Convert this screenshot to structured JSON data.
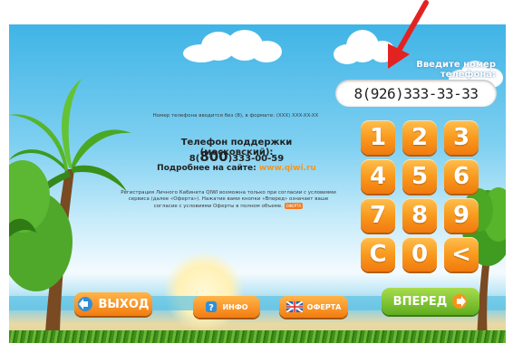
{
  "phone_prompt": "Введите номер телефона:",
  "phone_value": "8(926)333-33-33",
  "hint_text": "Номер телефона вводится без (8), в формате: (XXX) XXX-XX-XX",
  "support": {
    "title": "Телефон поддержки (московский):",
    "phone_prefix": "8(",
    "phone_code": "800",
    "phone_rest": ")333-00-59",
    "site_label": "Подробнее на сайте:",
    "site_url": "www.qiwi.ru"
  },
  "legal": {
    "text": "Регистрация Личного Кабинета QIWI возможна только при согласии с условиями сервиса (далее «Оферта»). Нажатие вами кнопки «Вперед» означает ваше согласие с условиями Оферты в полном объеме.",
    "tag": "ОФЕРТА"
  },
  "keypad": [
    "1",
    "2",
    "3",
    "4",
    "5",
    "6",
    "7",
    "8",
    "9",
    "C",
    "0",
    "<"
  ],
  "buttons": {
    "exit": "ВЫХОД",
    "info": "ИНФО",
    "offer": "ОФЕРТА",
    "next": "ВПЕРЕД"
  },
  "colors": {
    "key_orange": "#f99a1d",
    "next_green": "#5fae1f",
    "arrow_red": "#e32222",
    "link_orange": "#f7941d"
  },
  "icons": {
    "exit": "arrow-left-icon",
    "info": "question-icon",
    "offer": "flag-icon",
    "next": "arrow-right-icon",
    "annotation": "red-arrow-icon"
  }
}
